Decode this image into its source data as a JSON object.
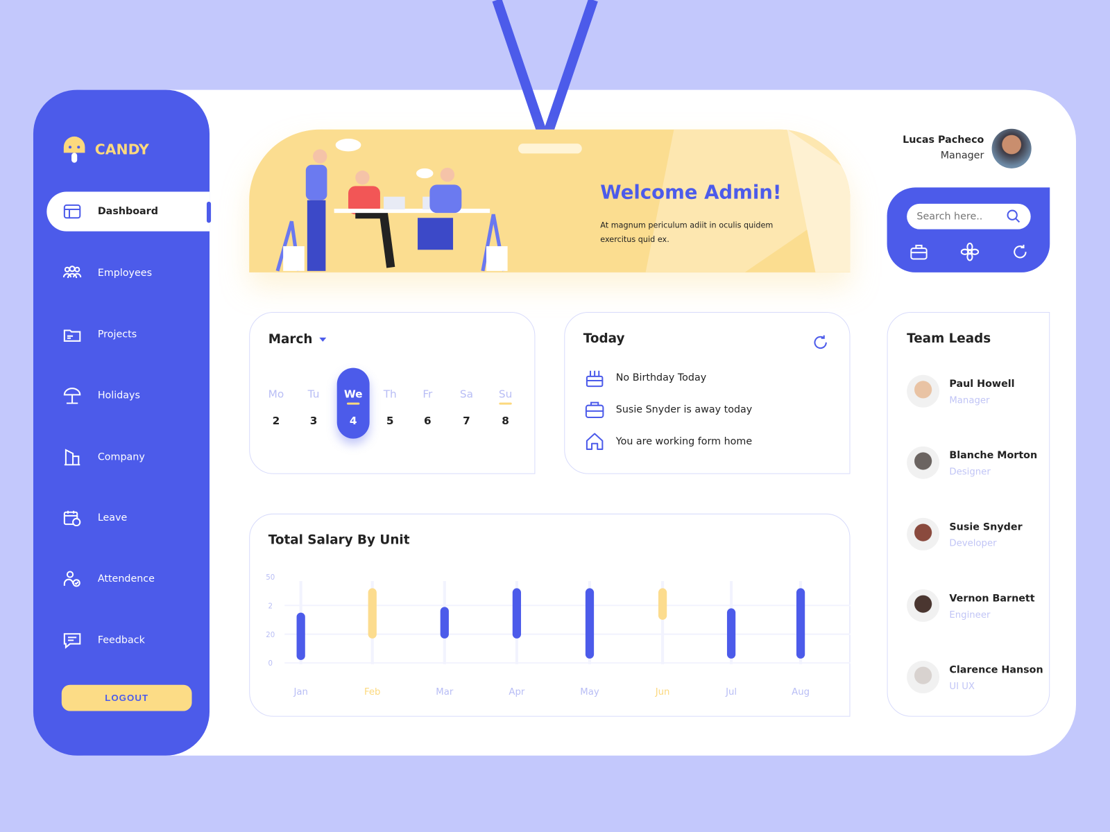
{
  "app": {
    "name": "CANDY"
  },
  "sidebar": {
    "items": [
      {
        "label": "Dashboard",
        "icon": "dashboard-icon",
        "active": true
      },
      {
        "label": "Employees",
        "icon": "employees-icon"
      },
      {
        "label": "Projects",
        "icon": "projects-icon"
      },
      {
        "label": "Holidays",
        "icon": "umbrella-icon"
      },
      {
        "label": "Company",
        "icon": "building-icon"
      },
      {
        "label": "Leave",
        "icon": "calendar-clock-icon"
      },
      {
        "label": "Attendence",
        "icon": "user-check-icon"
      },
      {
        "label": "Feedback",
        "icon": "chat-icon"
      }
    ],
    "logout": "LOGOUT"
  },
  "banner": {
    "title": "Welcome Admin!",
    "text": "At magnum periculum adiit in oculis quidem exercitus quid ex."
  },
  "user": {
    "name": "Lucas Pacheco",
    "role": "Manager"
  },
  "search": {
    "placeholder": "Search here..",
    "icons": [
      "briefcase-icon",
      "flower-icon",
      "refresh-icon"
    ]
  },
  "calendar": {
    "month": "March",
    "days": [
      {
        "name": "Mo",
        "num": "2"
      },
      {
        "name": "Tu",
        "num": "3"
      },
      {
        "name": "We",
        "num": "4",
        "selected": true
      },
      {
        "name": "Th",
        "num": "5"
      },
      {
        "name": "Fr",
        "num": "6"
      },
      {
        "name": "Sa",
        "num": "7"
      },
      {
        "name": "Su",
        "num": "8",
        "marked": true
      }
    ]
  },
  "today": {
    "title": "Today",
    "items": [
      {
        "icon": "cake-icon",
        "text": "No Birthday Today"
      },
      {
        "icon": "briefcase-icon",
        "text": "Susie Snyder is away today"
      },
      {
        "icon": "home-icon",
        "text": "You are working form home"
      }
    ]
  },
  "team": {
    "title": "Team Leads",
    "members": [
      {
        "name": "Paul Howell",
        "role": "Manager"
      },
      {
        "name": "Blanche Morton",
        "role": "Designer"
      },
      {
        "name": "Susie Snyder",
        "role": "Developer"
      },
      {
        "name": "Vernon Barnett",
        "role": "Engineer"
      },
      {
        "name": "Clarence Hanson",
        "role": "UI UX"
      }
    ]
  },
  "colors": {
    "primary": "#4c5bea",
    "accent": "#fcd97e",
    "background": "#c3c8fc"
  },
  "chart_data": {
    "type": "bar",
    "title": "Total Salary By Unit",
    "categories": [
      "Jan",
      "Feb",
      "Mar",
      "Apr",
      "May",
      "Jun",
      "Jul",
      "Aug"
    ],
    "y_ticks": [
      {
        "value": 0,
        "label": "0"
      },
      {
        "value": 20,
        "label": "20"
      },
      {
        "value": 40,
        "label": "2"
      },
      {
        "value": 60,
        "label": "50"
      }
    ],
    "ylim": [
      0,
      60
    ],
    "ranges": [
      [
        2,
        35
      ],
      [
        17,
        52
      ],
      [
        17,
        39
      ],
      [
        17,
        52
      ],
      [
        3,
        52
      ],
      [
        30,
        52
      ],
      [
        3,
        38
      ],
      [
        3,
        52
      ]
    ],
    "highlighted": [
      "Feb",
      "Jun"
    ],
    "grid": true
  }
}
